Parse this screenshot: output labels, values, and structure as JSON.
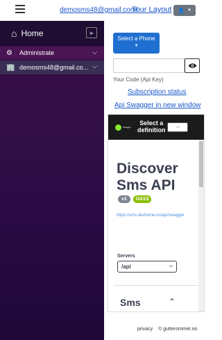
{
  "topbar": {
    "email": "demosms48@gmail.com!",
    "tour_label": "Tour Layout",
    "user_icon": "user-icon",
    "caret_icon": "caret-down-icon"
  },
  "sidebar": {
    "home_label": "Home",
    "items": [
      {
        "label": "Administrate",
        "icon": "gear-icon"
      },
      {
        "label": "demosms48@gmail.co...",
        "icon": "building-icon"
      }
    ]
  },
  "main": {
    "phone_button_label": "Select a Phone",
    "api_key_value": "",
    "api_key_label": "Your Code (Api Key)",
    "subscription_link": "Subscription status",
    "swagger_link": "Api Swagger in new window"
  },
  "swagger": {
    "logo_text": "Swagger",
    "select_label_1": "Select a",
    "select_label_2": "definition",
    "title_line1": "Discover",
    "title_line2": "Sms API",
    "version_badge": "v1",
    "oas_badge": "OAS3",
    "url": "https://sms.devhome.no/api/swagger",
    "servers_label": "Servers",
    "server_value": "/api",
    "tag_name": "Sms"
  },
  "footer": {
    "privacy": "privacy",
    "copyright": "© gutterommet.no"
  }
}
